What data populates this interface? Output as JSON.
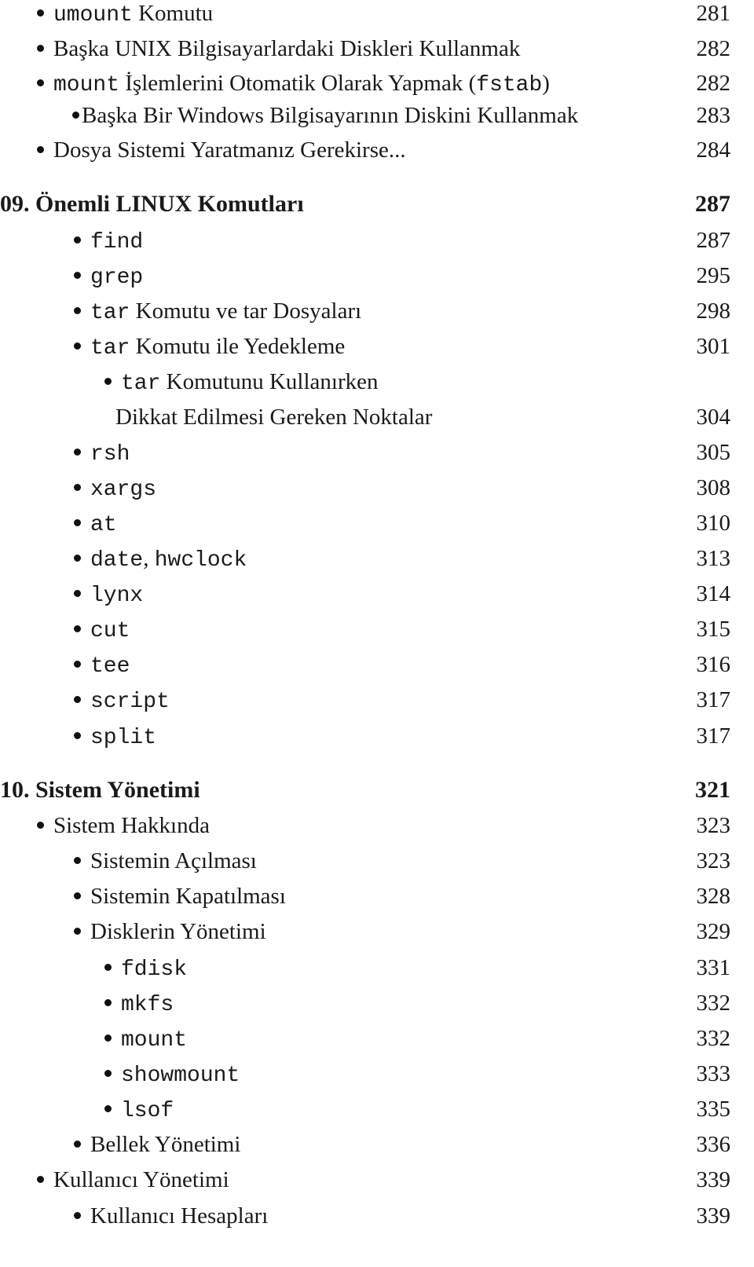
{
  "toc": {
    "entries": [
      {
        "level": 1,
        "code": "umount",
        "text": " Komutu",
        "page": "281"
      },
      {
        "level": 1,
        "code": "",
        "text": "Başka UNIX Bilgisayarlardaki Diskleri Kullanmak",
        "page": "282"
      },
      {
        "level": 1,
        "code": "mount",
        "text": " İşlemlerini Otomatik Olarak Yapmak (",
        "code2": "fstab",
        "text2": ")",
        "page": "282"
      },
      {
        "level": 2,
        "code": "",
        "text": "Başka Bir Windows Bilgisayarının Diskini Kullanmak",
        "page": "283"
      },
      {
        "level": 1,
        "code": "",
        "text": "Dosya Sistemi Yaratmanız Gerekirse...",
        "page": "284"
      }
    ],
    "chapter9": {
      "title": "09. Önemli LINUX Komutları",
      "page": "287",
      "entries": [
        {
          "code": "find",
          "text": "",
          "page": "287"
        },
        {
          "code": "grep",
          "text": "",
          "page": "295"
        },
        {
          "code": "tar",
          "text": " Komutu ve tar Dosyaları",
          "page": "298"
        },
        {
          "code": "tar",
          "text": " Komutu ile Yedekleme",
          "page": "301"
        },
        {
          "code": "tar",
          "text": " Komutunu Kullanırken",
          "continuation": "Dikkat Edilmesi Gereken Noktalar",
          "page": "304"
        },
        {
          "code": "rsh",
          "text": "",
          "page": "305"
        },
        {
          "code": "xargs",
          "text": "",
          "page": "308"
        },
        {
          "code": "at",
          "text": "",
          "page": "310"
        },
        {
          "code": "date",
          "text": ", ",
          "code2": "hwclock",
          "page": "313"
        },
        {
          "code": "lynx",
          "text": "",
          "page": "314"
        },
        {
          "code": "cut",
          "text": "",
          "page": "315"
        },
        {
          "code": "tee",
          "text": "",
          "page": "316"
        },
        {
          "code": "script",
          "text": "",
          "page": "317"
        },
        {
          "code": "split",
          "text": "",
          "page": "317"
        }
      ]
    },
    "chapter10": {
      "title": "10. Sistem Yönetimi",
      "page": "321",
      "entries": [
        {
          "text": "Sistem Hakkında",
          "page": "323"
        },
        {
          "text": "Sistemin Açılması",
          "page": "323"
        },
        {
          "text": "Sistemin Kapatılması",
          "page": "328"
        },
        {
          "text": "Disklerin Yönetimi",
          "page": "329"
        },
        {
          "code": "fdisk",
          "page": "331"
        },
        {
          "code": "mkfs",
          "page": "332"
        },
        {
          "code": "mount",
          "page": "332"
        },
        {
          "code": "showmount",
          "page": "333"
        },
        {
          "code": "lsof",
          "page": "335"
        },
        {
          "text": "Bellek Yönetimi",
          "page": "336"
        },
        {
          "text": "Kullanıcı Yönetimi",
          "page": "339"
        },
        {
          "text": "Kullanıcı Hesapları",
          "page": "339"
        }
      ]
    }
  }
}
